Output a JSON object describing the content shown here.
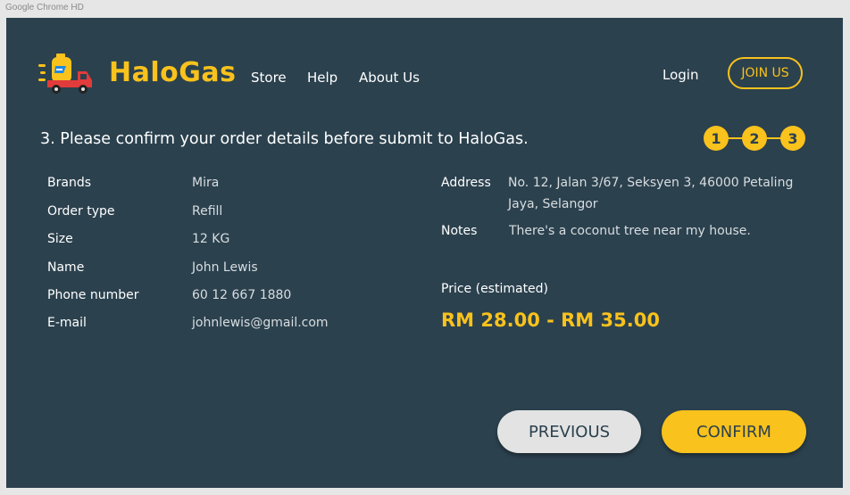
{
  "window": {
    "title": "Google Chrome HD"
  },
  "colors": {
    "accent": "#f9c21c",
    "background": "#2b414e",
    "button_secondary": "#e3e3e3"
  },
  "header": {
    "brand": "HaloGas",
    "logo_icon": "gas-delivery-truck-icon",
    "nav": [
      "Store",
      "Help",
      "About Us"
    ],
    "login": "Login",
    "join": "JOIN US"
  },
  "heading": "3. Please confirm your order details before submit to HaloGas.",
  "steps": [
    "1",
    "2",
    "3"
  ],
  "details": [
    {
      "label": "Brands",
      "value": "Mira"
    },
    {
      "label": "Order type",
      "value": "Refill"
    },
    {
      "label": "Size",
      "value": "12 KG"
    },
    {
      "label": "Name",
      "value": "John Lewis"
    },
    {
      "label": "Phone number",
      "value": "60 12 667 1880"
    },
    {
      "label": "E-mail",
      "value": "johnlewis@gmail.com"
    }
  ],
  "address": {
    "label": "Address",
    "line1": "No. 12, Jalan 3/67, Seksyen 3, 46000 Petaling",
    "line2": "Jaya, Selangor"
  },
  "notes": {
    "label": "Notes",
    "value": "There's a coconut tree near my house."
  },
  "price": {
    "label": "Price (estimated)",
    "value": "RM 28.00 - RM 35.00"
  },
  "buttons": {
    "previous": "PREVIOUS",
    "confirm": "CONFIRM"
  }
}
